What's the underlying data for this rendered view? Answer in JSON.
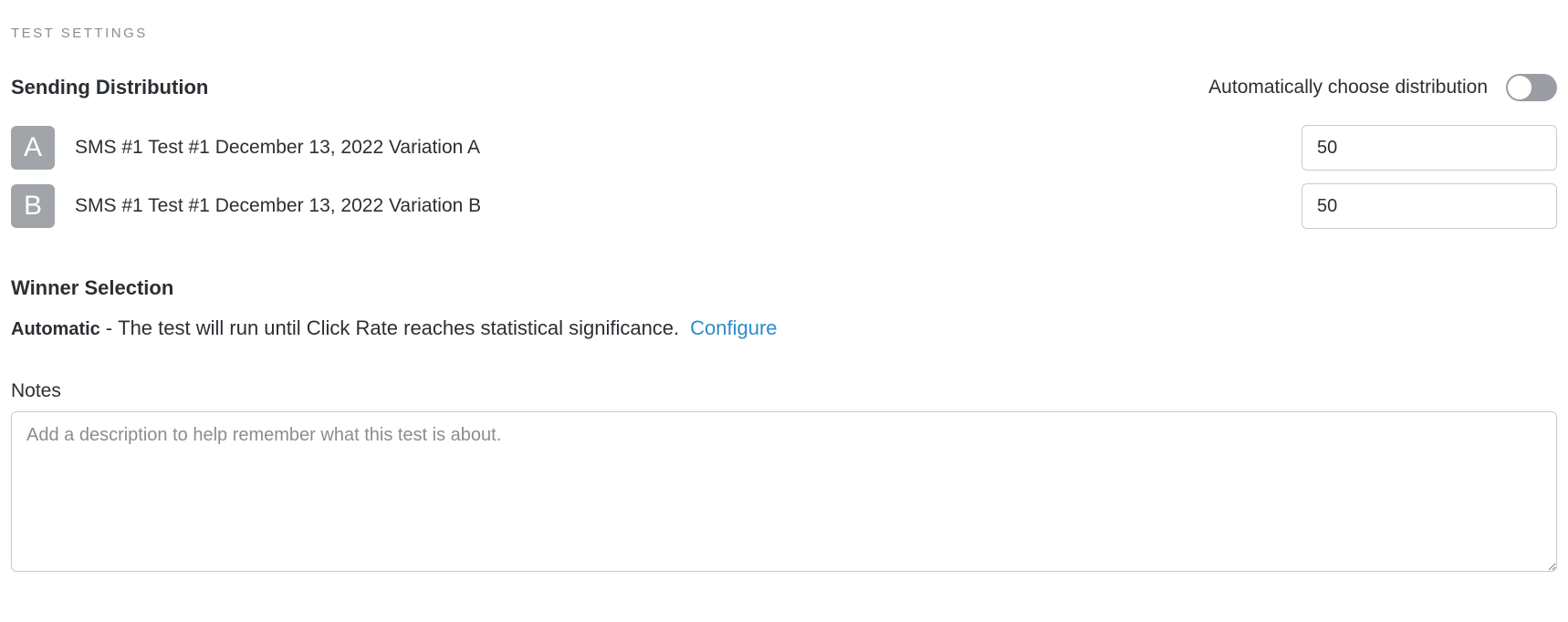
{
  "section_title": "TEST SETTINGS",
  "sending_distribution": {
    "heading": "Sending Distribution",
    "auto_label": "Automatically choose distribution",
    "auto_enabled": false,
    "variations": [
      {
        "badge": "A",
        "label": "SMS #1 Test #1 December 13, 2022 Variation A",
        "percent": "50",
        "suffix": "%"
      },
      {
        "badge": "B",
        "label": "SMS #1 Test #1 December 13, 2022 Variation B",
        "percent": "50",
        "suffix": "%"
      }
    ]
  },
  "winner_selection": {
    "heading": "Winner Selection",
    "mode": "Automatic",
    "separator": " - ",
    "description": "The test will run until Click Rate reaches statistical significance.",
    "configure_label": "Configure"
  },
  "notes": {
    "heading": "Notes",
    "placeholder": "Add a description to help remember what this test is about.",
    "value": ""
  }
}
